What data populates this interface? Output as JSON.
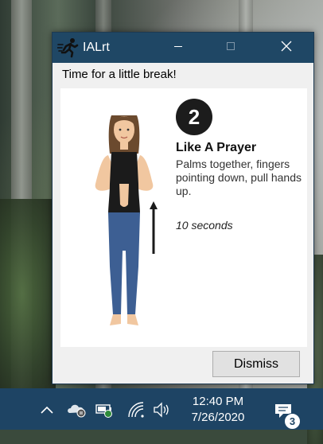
{
  "window": {
    "title": "IALrt",
    "message": "Time for a little break!"
  },
  "exercise": {
    "step": "2",
    "title": "Like A Prayer",
    "description": "Palms together, fingers pointing down, pull hands up.",
    "duration": "10 seconds"
  },
  "buttons": {
    "dismiss": "Dismiss"
  },
  "taskbar": {
    "time": "12:40 PM",
    "date": "7/26/2020",
    "notification_count": "3"
  },
  "colors": {
    "titlebar": "#1f4765",
    "taskbar": "#1e4464",
    "window_bg": "#f0f0f0"
  },
  "icons": [
    "runner-icon",
    "minimize-icon",
    "maximize-icon",
    "close-icon",
    "chevron-up-icon",
    "onedrive-icon",
    "battery-icon",
    "wifi-icon",
    "volume-icon",
    "notification-icon"
  ]
}
